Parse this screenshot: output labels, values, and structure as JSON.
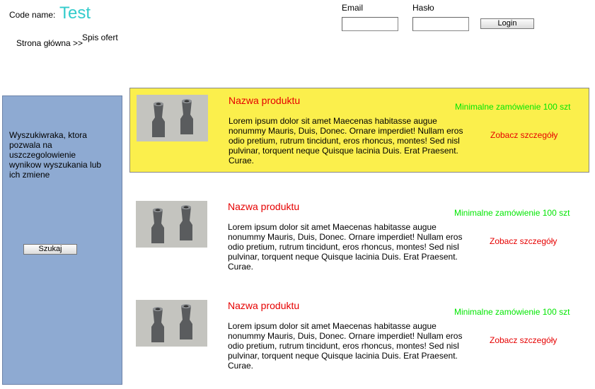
{
  "header": {
    "codename_label": "Code name:",
    "codename_value": "Test",
    "login": {
      "email_label": "Email",
      "email_value": "",
      "password_label": "Hasło",
      "password_value": "",
      "button_label": "Login"
    }
  },
  "breadcrumb": {
    "home": "Strona główna >>",
    "current": "Spis ofert"
  },
  "sidebar": {
    "description": "Wyszukiwraka, ktora pozwala na uszczegolowienie wynikow wyszukania lub ich zmiene",
    "search_button": "Szukaj",
    "background": "#8eaad2"
  },
  "products": [
    {
      "name": "Nazwa produktu",
      "description": "Lorem ipsum dolor sit amet Maecenas habitasse augue nonummy Mauris, Duis, Donec. Ornare imperdiet! Nullam eros odio pretium, rutrum tincidunt, eros rhoncus, montes! Sed nisl pulvinar, torquent neque Quisque lacinia Duis. Erat Praesent. Curae.",
      "min_order": "Minimalne zamówienie 100 szt",
      "details_link": "Zobacz szczegóły",
      "highlighted": true,
      "image": "product-photo"
    },
    {
      "name": "Nazwa produktu",
      "description": "Lorem ipsum dolor sit amet Maecenas habitasse augue nonummy Mauris, Duis, Donec. Ornare imperdiet! Nullam eros odio pretium, rutrum tincidunt, eros rhoncus, montes! Sed nisl pulvinar, torquent neque Quisque lacinia Duis. Erat Praesent. Curae.",
      "min_order": "Minimalne zamówienie 100 szt",
      "details_link": "Zobacz szczegóły",
      "highlighted": false,
      "image": "product-photo"
    },
    {
      "name": "Nazwa produktu",
      "description": "Lorem ipsum dolor sit amet Maecenas habitasse augue nonummy Mauris, Duis, Donec. Ornare imperdiet! Nullam eros odio pretium, rutrum tincidunt, eros rhoncus, montes! Sed nisl pulvinar, torquent neque Quisque lacinia Duis. Erat Praesent. Curae.",
      "min_order": "Minimalne zamówienie 100 szt",
      "details_link": "Zobacz szczegóły",
      "highlighted": false,
      "image": "product-photo"
    }
  ],
  "colors": {
    "codename": "#33cccc",
    "highlight": "#fbef4c",
    "product_name": "#e60000",
    "min_order": "#00e600",
    "details_link": "#e60000"
  }
}
